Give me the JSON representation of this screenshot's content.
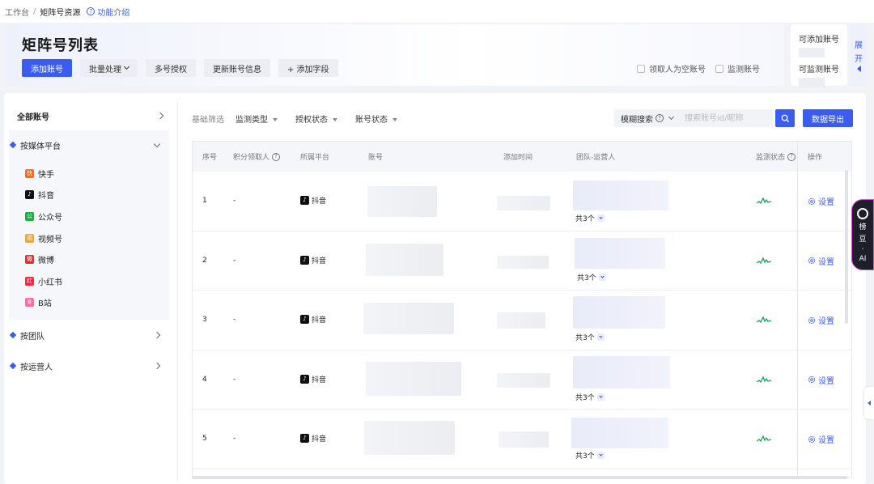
{
  "breadcrumb": {
    "root": "工作台",
    "separator": "/",
    "current": "矩阵号资源",
    "help": "功能介绍"
  },
  "header": {
    "title": "矩阵号列表",
    "buttons": {
      "add": "添加账号",
      "batch": "批量处理",
      "multi_auth": "多号授权",
      "update_info": "更新账号信息",
      "add_field": "+ 添加字段"
    },
    "checks": {
      "empty_claimer": "领取人为空账号",
      "monitored": "监测账号"
    }
  },
  "quota": {
    "can_add": "可添加账号",
    "can_monitor": "可监测账号",
    "expand": [
      "展",
      "开"
    ]
  },
  "sidebar": {
    "all_accounts": "全部账号",
    "by_platform": "按媒体平台",
    "platforms": [
      {
        "label": "快手",
        "color": "#ff6a1a",
        "icon": "kuaishou-icon",
        "glyph": "快"
      },
      {
        "label": "抖音",
        "color": "#111111",
        "icon": "douyin-icon",
        "glyph": "♪"
      },
      {
        "label": "公众号",
        "color": "#12b23c",
        "icon": "wechat-mp-icon",
        "glyph": "公"
      },
      {
        "label": "视频号",
        "color": "#f5a623",
        "icon": "channels-icon",
        "glyph": "视"
      },
      {
        "label": "微博",
        "color": "#e6302f",
        "icon": "weibo-icon",
        "glyph": "微"
      },
      {
        "label": "小红书",
        "color": "#ff2442",
        "icon": "xiaohongshu-icon",
        "glyph": "红"
      },
      {
        "label": "B站",
        "color": "#f76fa4",
        "icon": "bilibili-icon",
        "glyph": "B"
      }
    ],
    "by_team": "按团队",
    "by_operator": "按运营人"
  },
  "filters": {
    "basic": "基础筛选",
    "monitor_type": "监测类型",
    "auth_status": "授权状态",
    "account_status": "账号状态"
  },
  "search": {
    "mode": "模糊搜索",
    "placeholder": "搜索账号id/昵称"
  },
  "export": "数据导出",
  "table": {
    "headers": {
      "index": "序号",
      "claimer": "积分领取人",
      "platform": "所属平台",
      "account": "账号",
      "added_time": "添加时间",
      "team": "团队-运营人",
      "monitor": "监测状态",
      "ops": "操作"
    },
    "rows": [
      {
        "index": "1",
        "claimer": "-",
        "platform": "抖音",
        "total": "共3个",
        "action": "设置"
      },
      {
        "index": "2",
        "claimer": "-",
        "platform": "抖音",
        "total": "共3个",
        "action": "设置"
      },
      {
        "index": "3",
        "claimer": "-",
        "platform": "抖音",
        "total": "共3个",
        "action": "设置"
      },
      {
        "index": "4",
        "claimer": "-",
        "platform": "抖音",
        "total": "共3个",
        "action": "设置"
      },
      {
        "index": "5",
        "claimer": "-",
        "platform": "抖音",
        "total": "共3个",
        "action": "设置"
      }
    ]
  },
  "ai_assistant": {
    "name_line1": "榜",
    "name_line2": "豆",
    "name_dot": "·",
    "name_line3": "AI"
  },
  "colors": {
    "primary": "#3a5cf0",
    "monitor_ok": "#1aa35a"
  }
}
